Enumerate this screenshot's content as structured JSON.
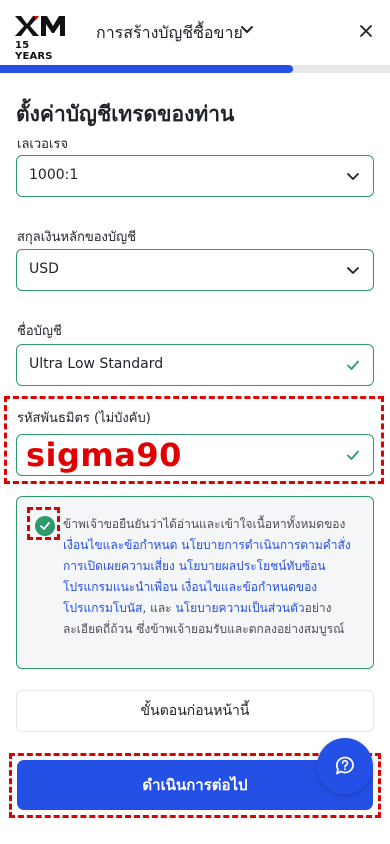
{
  "header": {
    "logo_text": "XM",
    "logo_years": "15 YEARS",
    "title": "การสร้างบัญชีซื้อขาย"
  },
  "progress": {
    "fraction": 0.75
  },
  "page": {
    "heading": "ตั้งค่าบัญชีเทรดของท่าน"
  },
  "leverage": {
    "label": "เลเวอเรจ",
    "value": "1000:1"
  },
  "currency": {
    "label": "สกุลเงินหลักของบัญชี",
    "value": "USD"
  },
  "account_name": {
    "label": "ชื่อบัญชี",
    "value": "Ultra Low Standard"
  },
  "referral": {
    "label": "รหัสพันธมิตร (ไม่บังคับ)",
    "value": "sigma90"
  },
  "terms": {
    "checked": true,
    "text_1": "ข้าพเจ้าขอยืนยันว่าได้อ่านและเข้าใจเนื้อหาทั้งหมดของ",
    "link_1": "เงื่อนไขและข้อกำหนด",
    "text_2": " ",
    "link_2": "นโยบายการดำเนินการตามคำสั่ง",
    "text_3": " ",
    "link_3": "การเปิดเผยความเสี่ยง",
    "text_4": " ",
    "link_4": "นโยบายผลประโยชน์ทับซ้อน",
    "text_5": " ",
    "link_5": "โปรแกรมแนะนำเพื่อน",
    "text_6": " ",
    "link_6": "เงื่อนไขและข้อกำหนดของโปรแกรมโบนัส",
    "text_7": ", และ ",
    "link_7": "นโยบายความเป็นส่วนตัว",
    "text_8": "อย่างละเอียดถี่ถ้วน ซึ่งข้าพเจ้ายอมรับและตกลงอย่างสมบูรณ์"
  },
  "buttons": {
    "back": "ขั้นตอนก่อนหน้านี้",
    "continue": "ดำเนินการต่อไป"
  },
  "colors": {
    "accent": "#2550e6",
    "success": "#2e9a6b",
    "highlight": "#e00000"
  }
}
